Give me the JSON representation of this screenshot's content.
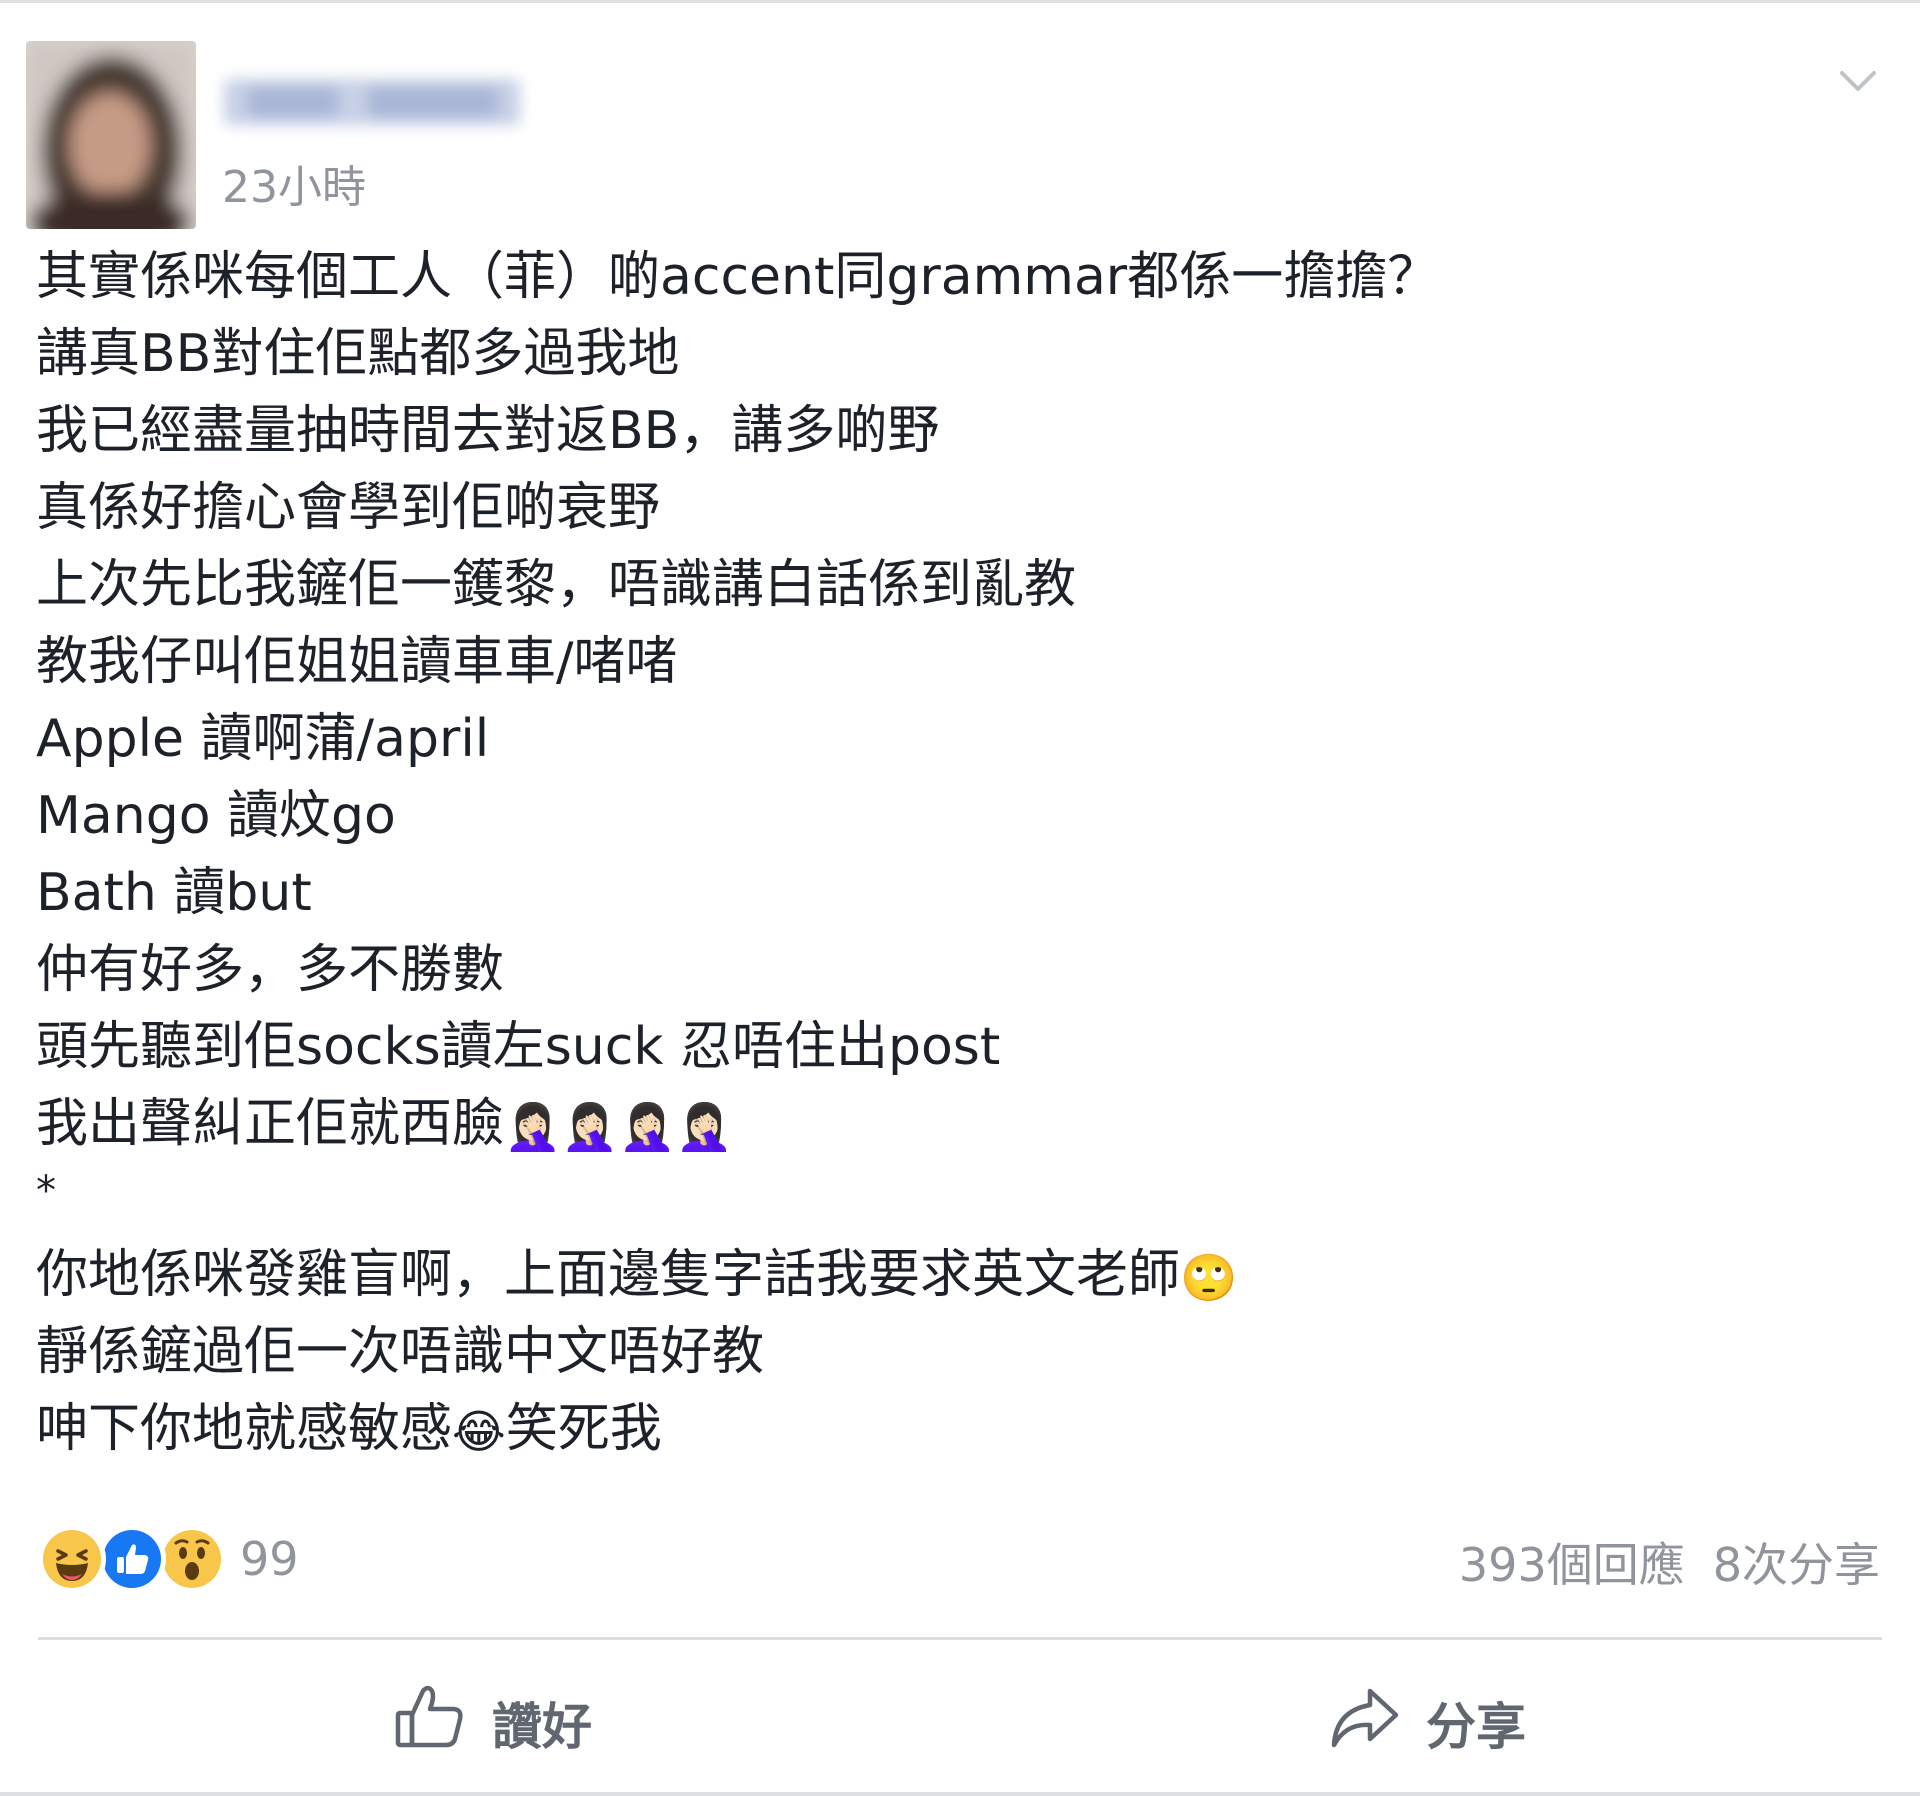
{
  "post": {
    "author_name": "",
    "timestamp": "23小時",
    "lines": [
      "其實係咪每個工人（菲）啲accent同grammar都係一擔擔？",
      "講真BB對住佢點都多過我地",
      "我已經盡量抽時間去對返BB，講多啲野",
      "真係好擔心會學到佢啲衰野",
      "上次先比我鏟佢一鑊黎，唔識講白話係到亂教",
      "教我仔叫佢姐姐讀車車/啫啫",
      "Apple 讀啊蒲/april",
      "Mango 讀炆go",
      "Bath 讀but",
      "仲有好多，多不勝數",
      "頭先聽到佢socks讀左suck 忍唔住出post",
      "我出聲糾正佢就西臉",
      "*",
      "你地係咪發雞盲啊，上面邊隻字話我要求英文老師",
      "靜係鏟過佢一次唔識中文唔好教",
      "呻下你地就感敏感",
      "笑死我"
    ],
    "emojis": {
      "facepalm": "🤦🏻‍♀️🤦🏻‍♀️🤦🏻‍♀️🤦🏻‍♀️",
      "rolling_eyes": "🙄",
      "tears_of_joy": "😂"
    }
  },
  "reactions": {
    "icons": [
      "haha-icon",
      "like-icon",
      "wow-icon"
    ],
    "count": "99"
  },
  "stats": {
    "comments": "393個回應",
    "shares": "8次分享"
  },
  "actions": {
    "like_label": "讚好",
    "share_label": "分享"
  },
  "colors": {
    "text": "#1d2129",
    "meta": "#90949c",
    "like_blue": "#1877f2",
    "reaction_yellow": "#f7c64a",
    "divider": "#dadde1"
  }
}
